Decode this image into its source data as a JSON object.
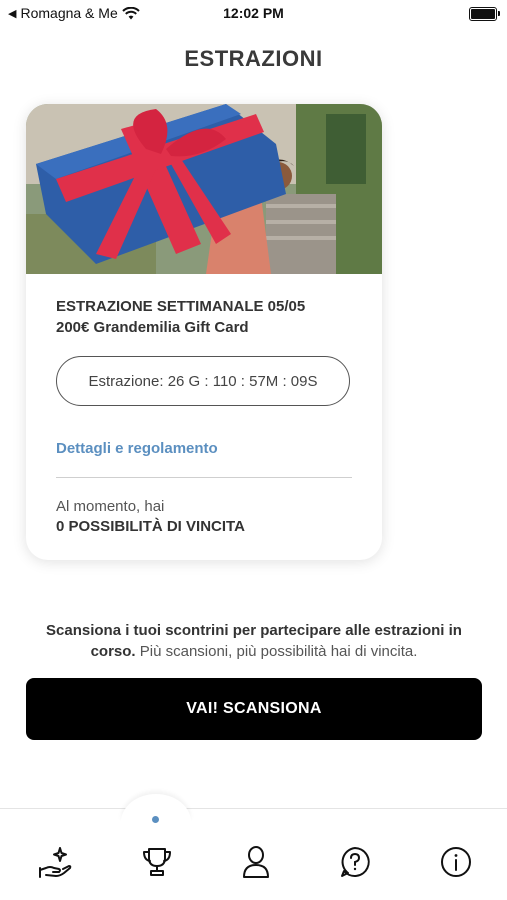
{
  "status_bar": {
    "carrier": "Romagna & Me",
    "time": "12:02 PM"
  },
  "header": {
    "title": "ESTRAZIONI"
  },
  "draw_card": {
    "title": "ESTRAZIONE SETTIMANALE 05/05",
    "prize": "200€ Grandemilia Gift Card",
    "countdown": "Estrazione: 26 G : 110 : 57M : 09S",
    "details_link": "Dettagli e regolamento",
    "chance_label": "Al momento, hai",
    "chance_value": "0 POSSIBILITÀ DI VINCITA"
  },
  "info": {
    "bold": "Scansiona i tuoi scontrini per partecipare alle estrazioni in corso.",
    "normal": " Più scansioni, più possibilità hai di vincita."
  },
  "cta": {
    "label": "VAI! SCANSIONA"
  },
  "tabbar": {
    "active_index": 1,
    "tabs": [
      {
        "icon": "hand-sparkle-icon"
      },
      {
        "icon": "trophy-icon"
      },
      {
        "icon": "user-icon"
      },
      {
        "icon": "help-icon"
      },
      {
        "icon": "info-icon"
      }
    ]
  },
  "colors": {
    "link": "#5b8fc0",
    "cta_bg": "#000000",
    "title": "#3a3a3a"
  }
}
